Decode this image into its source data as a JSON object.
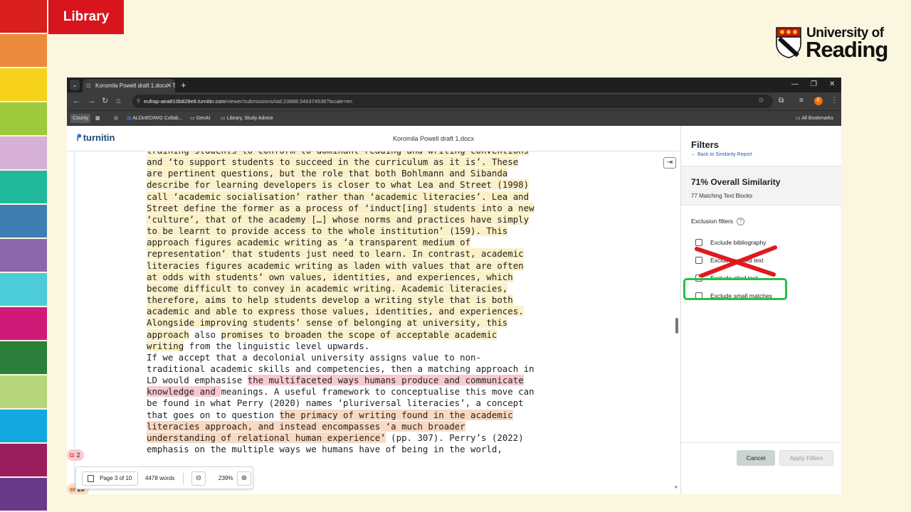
{
  "slide": {
    "library_label": "Library",
    "university_line1": "University of",
    "university_line2": "Reading",
    "strip_colors": [
      "#d81e1e",
      "#ea8a3a",
      "#f7d21a",
      "#9ec93a",
      "#d6b0d6",
      "#1fb89a",
      "#3e7fb3",
      "#8a68aa",
      "#4ccbd9",
      "#d01a78",
      "#2a7f3a",
      "#b5d67a",
      "#13a8df",
      "#9b1f5e",
      "#6a3a8a"
    ]
  },
  "browser": {
    "tab_title": "Koromila Powell draft 1.docx - T",
    "url_host": "eufrap-aea810b828e8.turnitin.com",
    "url_path": "/viewer/submissions/oid:23888:346374536?locale=en",
    "profile_initial": "E",
    "bookmarks": {
      "county": "County",
      "aldin": "ALDinEDIWG Collab...",
      "genai": "GenAI",
      "library": "Library, Study Advice",
      "all": "All Bookmarks"
    }
  },
  "viewer": {
    "logo": "turnitin",
    "doc_title": "Koromila Powell draft 1.docx",
    "badges": {
      "first": "2",
      "second": "20"
    },
    "pagebar": {
      "page": "Page 3 of 10",
      "words": "4478 words",
      "zoom": "239%"
    }
  },
  "filters": {
    "title": "Filters",
    "back_link": "Back to Similarity Report",
    "similarity": "71% Overall Similarity",
    "blocks": "77 Matching Text Blocks",
    "exclusion_heading": "Exclusion filters",
    "options": [
      "Exclude bibliography",
      "Exclude quoted text",
      "Exclude cited text",
      "Exclude small matches"
    ],
    "cancel": "Cancel",
    "apply": "Apply Filters"
  }
}
